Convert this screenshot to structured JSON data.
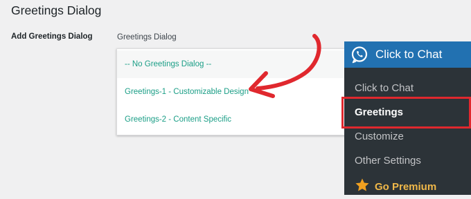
{
  "page": {
    "title": "Greetings Dialog"
  },
  "setting": {
    "label": "Add Greetings Dialog",
    "field_caption": "Greetings Dialog"
  },
  "dropdown": {
    "selected_index": 0,
    "options": [
      "-- No Greetings Dialog --",
      "Greetings-1 - Customizable Design",
      "Greetings-2 - Content Specific"
    ]
  },
  "admin_menu": {
    "header_label": "Click to Chat",
    "header_icon": "whatsapp-icon",
    "items": [
      "Click to Chat",
      "Greetings",
      "Customize",
      "Other Settings"
    ],
    "current_item": "Greetings",
    "premium": {
      "label": "Go Premium",
      "icon": "star-icon"
    }
  },
  "colors": {
    "option_text": "#1a9e86",
    "menu_bg": "#2c3338",
    "menu_header_bg": "#2271b1",
    "highlight": "#e0282e",
    "premium": "#f0b849"
  }
}
